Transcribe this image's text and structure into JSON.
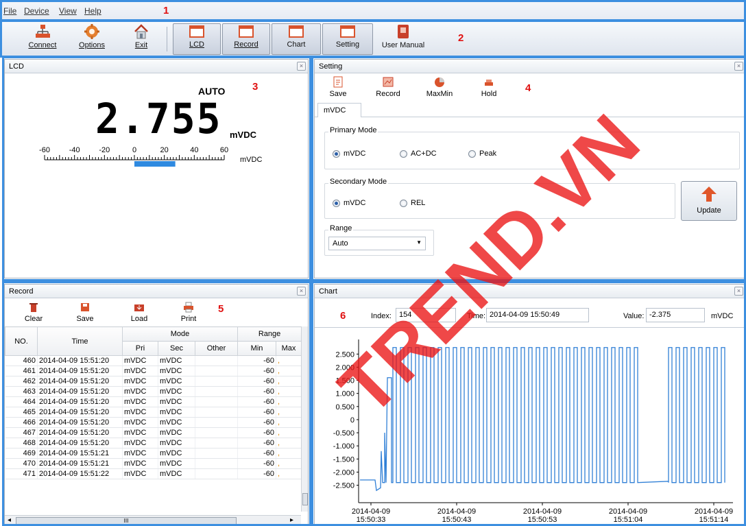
{
  "menu": {
    "file": "File",
    "device": "Device",
    "view": "View",
    "help": "Help"
  },
  "callouts": {
    "c1": "1",
    "c2": "2",
    "c3": "3",
    "c4": "4",
    "c5": "5",
    "c6": "6"
  },
  "toolbar": {
    "connect": "Connect",
    "options": "Options",
    "exit": "Exit",
    "lcd": "LCD",
    "record": "Record",
    "chart": "Chart",
    "setting": "Setting",
    "user_manual": "User Manual"
  },
  "lcd_panel": {
    "title": "LCD",
    "auto": "AUTO",
    "reading": "2.755",
    "unit": "mVDC",
    "scale_unit": "mVDC",
    "scale_labels": [
      "-60",
      "-40",
      "-20",
      "0",
      "20",
      "40",
      "60"
    ],
    "bar_from": 0,
    "bar_to": 20
  },
  "setting_panel": {
    "title": "Setting",
    "save": "Save",
    "record": "Record",
    "maxmin": "MaxMin",
    "hold": "Hold",
    "tab": "mVDC",
    "primary_title": "Primary Mode",
    "primary_options": [
      "mVDC",
      "AC+DC",
      "Peak"
    ],
    "secondary_title": "Secondary Mode",
    "secondary_options": [
      "mVDC",
      "REL"
    ],
    "update": "Update",
    "range_title": "Range",
    "range_value": "Auto"
  },
  "record_panel": {
    "title": "Record",
    "clear": "Clear",
    "save": "Save",
    "load": "Load",
    "print": "Print",
    "headers": {
      "no": "NO.",
      "time": "Time",
      "mode": "Mode",
      "range": "Range",
      "pri": "Pri",
      "sec": "Sec",
      "other": "Other",
      "min": "Min",
      "max": "Max"
    },
    "rows": [
      [
        "460",
        "2014-04-09 15:51:20",
        "mVDC",
        "mVDC",
        "",
        "-60"
      ],
      [
        "461",
        "2014-04-09 15:51:20",
        "mVDC",
        "mVDC",
        "",
        "-60"
      ],
      [
        "462",
        "2014-04-09 15:51:20",
        "mVDC",
        "mVDC",
        "",
        "-60"
      ],
      [
        "463",
        "2014-04-09 15:51:20",
        "mVDC",
        "mVDC",
        "",
        "-60"
      ],
      [
        "464",
        "2014-04-09 15:51:20",
        "mVDC",
        "mVDC",
        "",
        "-60"
      ],
      [
        "465",
        "2014-04-09 15:51:20",
        "mVDC",
        "mVDC",
        "",
        "-60"
      ],
      [
        "466",
        "2014-04-09 15:51:20",
        "mVDC",
        "mVDC",
        "",
        "-60"
      ],
      [
        "467",
        "2014-04-09 15:51:20",
        "mVDC",
        "mVDC",
        "",
        "-60"
      ],
      [
        "468",
        "2014-04-09 15:51:20",
        "mVDC",
        "mVDC",
        "",
        "-60"
      ],
      [
        "469",
        "2014-04-09 15:51:21",
        "mVDC",
        "mVDC",
        "",
        "-60"
      ],
      [
        "470",
        "2014-04-09 15:51:21",
        "mVDC",
        "mVDC",
        "",
        "-60"
      ],
      [
        "471",
        "2014-04-09 15:51:22",
        "mVDC",
        "mVDC",
        "",
        "-60"
      ]
    ],
    "scroll_marker": "III"
  },
  "chart_panel": {
    "title": "Chart",
    "index_label": "Index:",
    "index_value": "154",
    "time_label": "Time:",
    "time_value": "2014-04-09 15:50:49",
    "value_label": "Value:",
    "value_value": "-2.375",
    "unit": "mVDC"
  },
  "chart_data": {
    "type": "line",
    "y_ticks": [
      "2.500",
      "2.000",
      "1.500",
      "1.000",
      "0.500",
      "0",
      "-0.500",
      "-1.000",
      "-1.500",
      "-2.000",
      "-2.500"
    ],
    "ylim": [
      -2.8,
      2.9
    ],
    "x_ticks": [
      {
        "date": "2014-04-09",
        "time": "15:50:33"
      },
      {
        "date": "2014-04-09",
        "time": "15:50:43"
      },
      {
        "date": "2014-04-09",
        "time": "15:50:53"
      },
      {
        "date": "2014-04-09",
        "time": "15:51:04"
      },
      {
        "date": "2014-04-09",
        "time": "15:51:14"
      }
    ],
    "series_color": "#2f7fd6",
    "high": 2.75,
    "low": -2.4,
    "grid": false
  },
  "watermark": "TREND.VN"
}
